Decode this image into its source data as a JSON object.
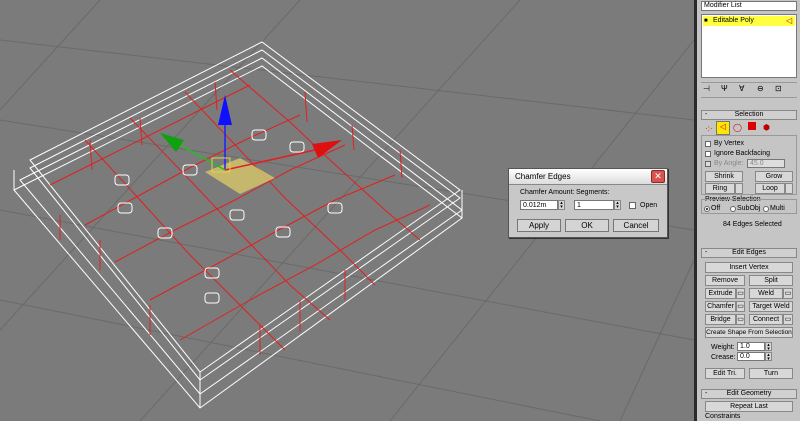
{
  "dialog": {
    "title": "Chamfer Edges",
    "close_glyph": "✕",
    "chamfer_amount_label": "Chamfer Amount:",
    "chamfer_amount_value": "0.012m",
    "segments_label": "Segments:",
    "segments_value": "1",
    "open_label": "Open",
    "apply_label": "Apply",
    "ok_label": "OK",
    "cancel_label": "Cancel"
  },
  "panel": {
    "modifier_list": "Modifier List",
    "stack_item": "Editable Poly",
    "selection": {
      "title": "Selection",
      "by_vertex": "By Vertex",
      "ignore_backfacing": "Ignore Backfacing",
      "by_angle": "By Angle:",
      "by_angle_value": "45.0",
      "shrink": "Shrink",
      "grow": "Grow",
      "ring": "Ring",
      "loop": "Loop",
      "preview_selection": "Preview Selection",
      "off": "Off",
      "subobj": "SubObj",
      "multi": "Multi",
      "status": "84 Edges Selected"
    },
    "edit_edges": {
      "title": "Edit Edges",
      "insert_vertex": "Insert Vertex",
      "remove": "Remove",
      "split": "Split",
      "extrude": "Extrude",
      "weld": "Weld",
      "chamfer": "Chamfer",
      "target_weld": "Target Weld",
      "bridge": "Bridge",
      "connect": "Connect",
      "create_shape": "Create Shape From Selection",
      "weight_label": "Weight:",
      "weight_value": "1.0",
      "crease_label": "Crease:",
      "crease_value": "0.0",
      "edit_tri": "Edit Tri.",
      "turn": "Turn"
    },
    "edit_geometry": {
      "title": "Edit Geometry",
      "repeat_last": "Repeat Last",
      "constraints": "Constraints"
    },
    "rollout_minus": "-"
  },
  "colors": {
    "viewport": "#7b7b7b",
    "selected_edge": "#e02020",
    "wire": "#ffffff",
    "stack_highlight": "#ffff40"
  }
}
